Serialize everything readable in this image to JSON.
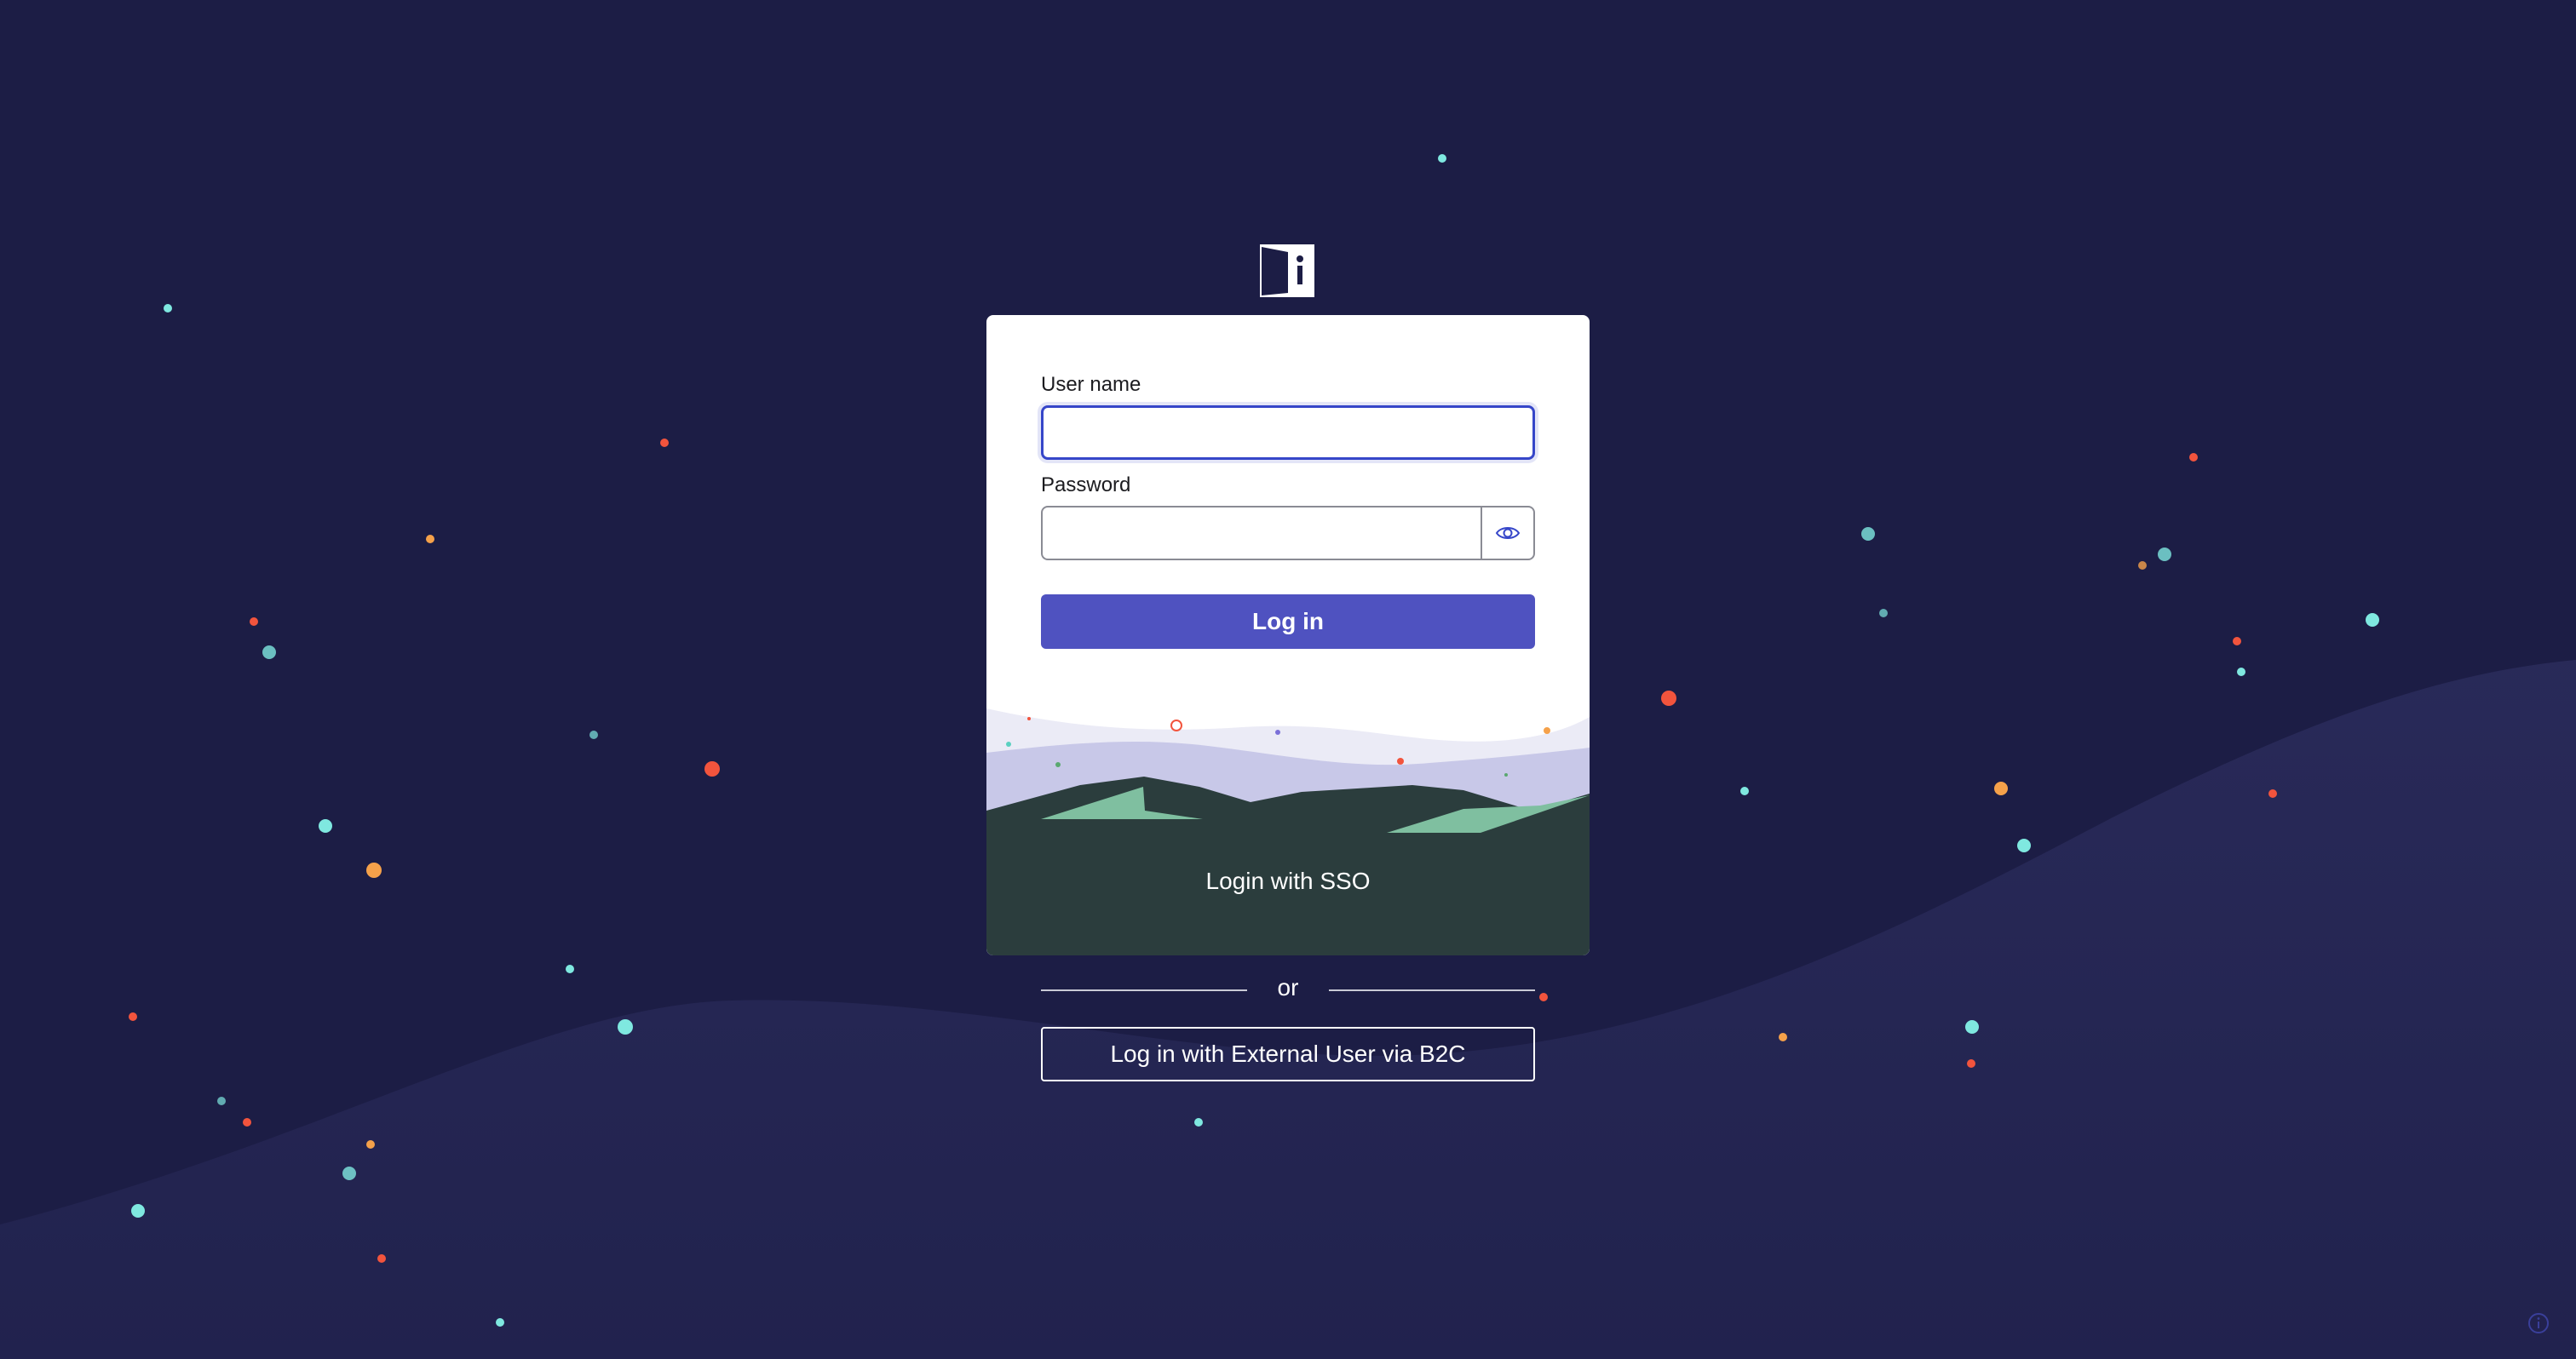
{
  "login": {
    "username_label": "User name",
    "username_value": "",
    "password_label": "Password",
    "password_value": "",
    "login_button": "Log in",
    "sso_button": "Login with SSO",
    "or_text": "or",
    "external_button": "Log in with External User via B2C"
  },
  "icons": {
    "logo": "door-info-logo",
    "password_toggle": "eye-icon",
    "corner": "info-circle-icon"
  },
  "colors": {
    "background": "#1c1d45",
    "primary_button": "#4f52c0",
    "focus_border": "#3646c9",
    "card": "#ffffff",
    "scene_ground": "#2b3d3d",
    "scene_hills": "#7fbfa0",
    "confetti_teal": "#7fe8e0",
    "confetti_red": "#f2543d",
    "confetti_orange": "#f5a14a"
  }
}
